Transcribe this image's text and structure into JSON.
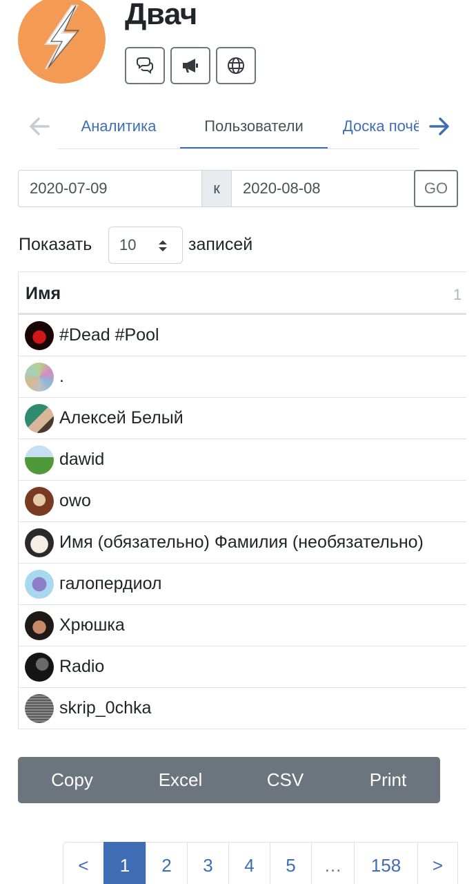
{
  "app": {
    "title": "Двач"
  },
  "header": {
    "buttons": [
      {
        "icon": "chat-bubbles-icon"
      },
      {
        "icon": "megaphone-icon"
      },
      {
        "icon": "globe-icon"
      }
    ]
  },
  "tabs": {
    "items": [
      "Аналитика",
      "Пользователи",
      "Доска почёта"
    ],
    "active": "Пользователи"
  },
  "date_range": {
    "from": "2020-07-09",
    "separator": "к",
    "to": "2020-08-08",
    "go_label": "GO"
  },
  "length": {
    "prefix": "Показать",
    "value": "10",
    "suffix": "записей"
  },
  "table": {
    "columns": [
      "Имя",
      "1"
    ],
    "rows": [
      {
        "name": "#Dead #Pool"
      },
      {
        "name": "."
      },
      {
        "name": "Алексей Белый"
      },
      {
        "name": "dawid"
      },
      {
        "name": "owo"
      },
      {
        "name": "Имя (обязательно) Фамилия (необязательно)"
      },
      {
        "name": "галопердиол"
      },
      {
        "name": "Хрюшка"
      },
      {
        "name": "Radio"
      },
      {
        "name": "skrip_0chka"
      }
    ]
  },
  "exports": [
    "Copy",
    "Excel",
    "CSV",
    "Print"
  ],
  "pagination": {
    "prev": "<",
    "pages": [
      "1",
      "2",
      "3",
      "4",
      "5",
      "…",
      "158"
    ],
    "next": ">",
    "current": "1"
  },
  "colors": {
    "accent": "#3f6db5",
    "logo": "#f39a55",
    "export_bar": "#6c757d"
  }
}
